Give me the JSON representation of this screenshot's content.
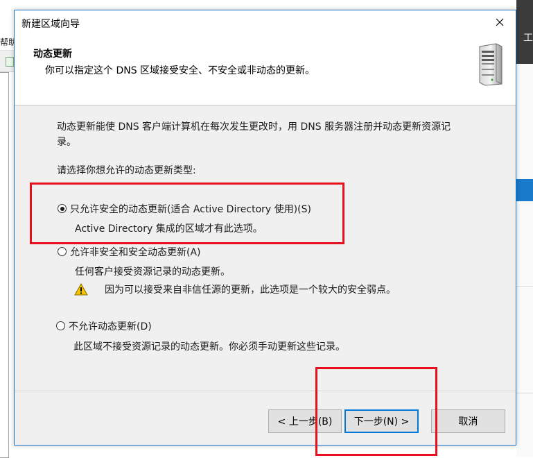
{
  "background": {
    "left_menu_fragment": "帮助",
    "right_dark_fragment": "工"
  },
  "dialog": {
    "title": "新建区域向导",
    "header": {
      "title": "动态更新",
      "subtitle": "你可以指定这个 DNS 区域接受安全、不安全或非动态的更新。"
    },
    "description_line1": "动态更新能使 DNS 客户端计算机在每次发生更改时，用 DNS 服务器注册并动态更新资源记",
    "description_line2": "录。",
    "prompt": "请选择你想允许的动态更新类型:",
    "options": [
      {
        "label": "只允许安全的动态更新(适合 Active Directory 使用)(S)",
        "desc": "Active Directory 集成的区域才有此选项。",
        "checked": true
      },
      {
        "label": "允许非安全和安全动态更新(A)",
        "desc": "任何客户接受资源记录的动态更新。",
        "warning": "因为可以接受来自非信任源的更新，此选项是一个较大的安全弱点。",
        "checked": false
      },
      {
        "label": "不允许动态更新(D)",
        "desc": "此区域不接受资源记录的动态更新。你必须手动更新这些记录。",
        "checked": false
      }
    ],
    "buttons": {
      "back": "< 上一步(B)",
      "next": "下一步(N) >",
      "cancel": "取消"
    }
  },
  "colors": {
    "accent": "#0078d7",
    "annotation_red": "#e8101c",
    "dialog_bg": "#f0f0f0"
  },
  "icons": {
    "close": "close-icon",
    "server": "server-icon",
    "warning": "warning-icon"
  }
}
